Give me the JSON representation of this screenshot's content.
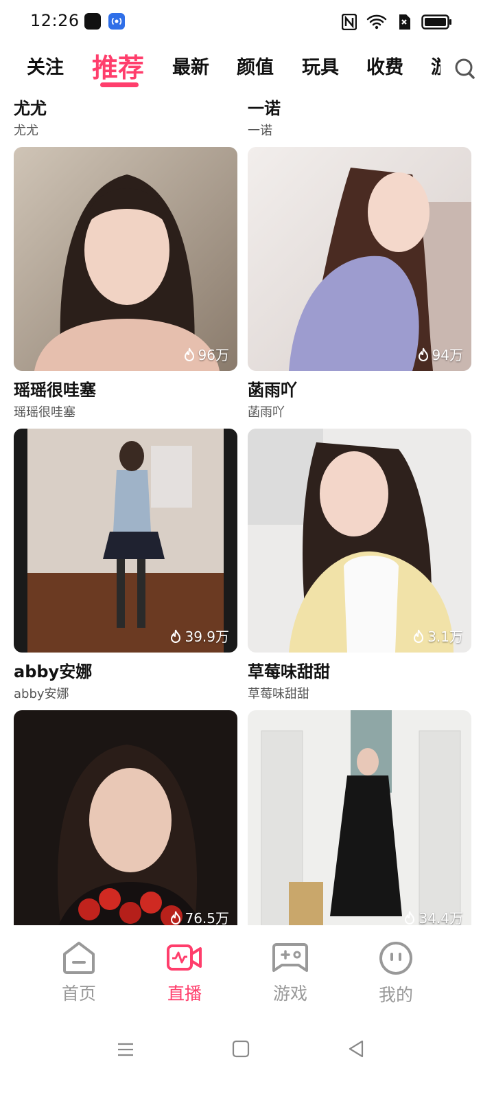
{
  "status": {
    "time": "12:26"
  },
  "tabs": [
    "关注",
    "推荐",
    "最新",
    "颜值",
    "玩具",
    "收费",
    "游"
  ],
  "active_tab": "推荐",
  "top_row": [
    {
      "name": "尤尤",
      "sub": "尤尤"
    },
    {
      "name": "一诺",
      "sub": "一诺"
    }
  ],
  "cards": [
    {
      "name": "瑶瑶很哇塞",
      "sub": "瑶瑶很哇塞",
      "heat": "96万"
    },
    {
      "name": "菡雨吖",
      "sub": "菡雨吖",
      "heat": "94万"
    },
    {
      "name": "abby安娜",
      "sub": "abby安娜",
      "heat": "39.9万"
    },
    {
      "name": "草莓味甜甜",
      "sub": "草莓味甜甜",
      "heat": "3.1万"
    },
    {
      "name": "",
      "sub": "",
      "heat": "76.5万"
    },
    {
      "name": "",
      "sub": "",
      "heat": "34.4万"
    }
  ],
  "bottom_nav": [
    "首页",
    "直播",
    "游戏",
    "我的"
  ],
  "colors": {
    "accent": "#ff3e6c",
    "inactive": "#999999"
  }
}
